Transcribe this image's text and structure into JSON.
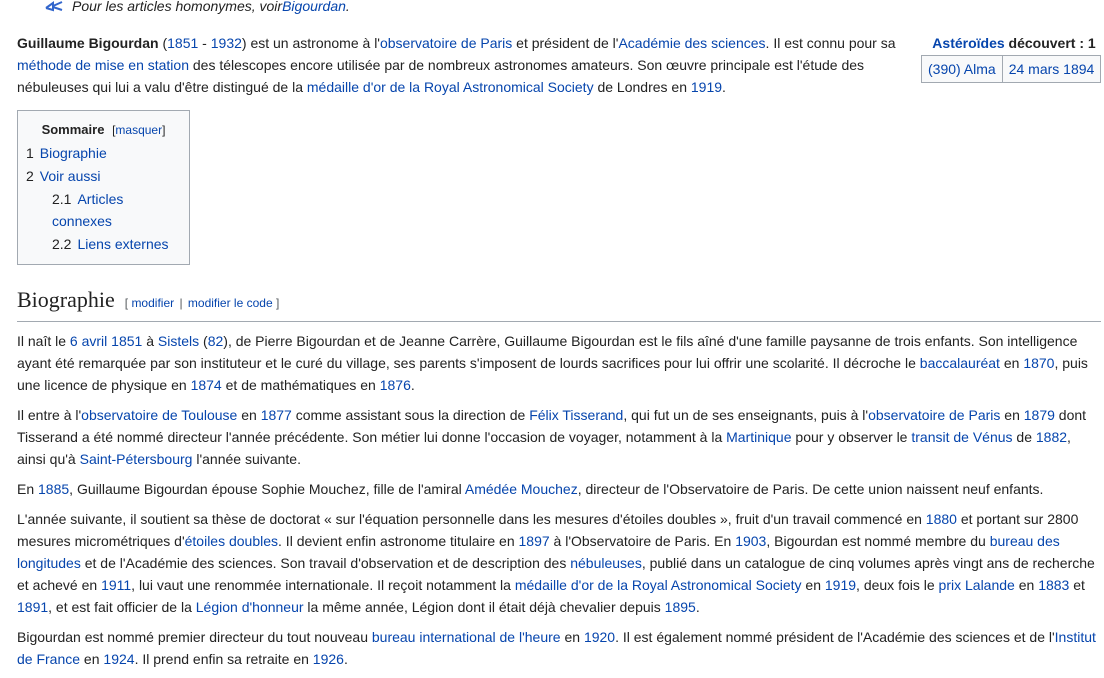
{
  "hatnote": {
    "text": "Pour les articles homonymes, voir ",
    "link": "Bigourdan",
    "end": "."
  },
  "infobox": {
    "title_link": "Astéroïdes",
    "title_rest": " découvert : 1",
    "rows": [
      {
        "name": "(390) Alma",
        "date": "24 mars 1894"
      }
    ]
  },
  "lead": [
    {
      "t": "Guillaume Bigourdan",
      "b": true
    },
    {
      "t": " ("
    },
    {
      "t": "1851",
      "l": true
    },
    {
      "t": " - "
    },
    {
      "t": "1932",
      "l": true
    },
    {
      "t": ") est un astronome à l'"
    },
    {
      "t": "observatoire de Paris",
      "l": true
    },
    {
      "t": " et président de l'"
    },
    {
      "t": "Académie des sciences",
      "l": true
    },
    {
      "t": ". Il est connu pour sa "
    },
    {
      "t": "méthode de mise en station",
      "l": true
    },
    {
      "t": " des télescopes encore utilisée par de nombreux astronomes amateurs. Son œuvre principale est l'étude des nébuleuses qui lui a valu d'être distingué de la "
    },
    {
      "t": "médaille d'or de la Royal Astronomical Society",
      "l": true
    },
    {
      "t": " de Londres en "
    },
    {
      "t": "1919",
      "l": true
    },
    {
      "t": "."
    }
  ],
  "toc": {
    "title": "Sommaire",
    "toggle_open": "[",
    "toggle": "masquer",
    "toggle_close": "]",
    "items": [
      {
        "num": "1",
        "label": "Biographie"
      },
      {
        "num": "2",
        "label": "Voir aussi"
      }
    ],
    "subitems": [
      {
        "num": "2.1",
        "label": "Articles connexes"
      },
      {
        "num": "2.2",
        "label": "Liens externes"
      }
    ]
  },
  "section": {
    "title": "Biographie",
    "edit_open": "[ ",
    "edit1": "modifier",
    "edit_sep": " | ",
    "edit2": "modifier le code",
    "edit_close": " ]"
  },
  "paragraphs": [
    [
      {
        "t": "Il naît le "
      },
      {
        "t": "6 avril",
        "l": true
      },
      {
        "t": " "
      },
      {
        "t": "1851",
        "l": true
      },
      {
        "t": " à "
      },
      {
        "t": "Sistels",
        "l": true
      },
      {
        "t": " ("
      },
      {
        "t": "82",
        "l": true
      },
      {
        "t": "), de Pierre Bigourdan et de Jeanne Carrère, Guillaume Bigourdan est le fils aîné d'une famille paysanne de trois enfants. Son intelligence ayant été remarquée par son instituteur et le curé du village, ses parents s'imposent de lourds sacrifices pour lui offrir une scolarité. Il décroche le "
      },
      {
        "t": "baccalauréat",
        "l": true
      },
      {
        "t": " en "
      },
      {
        "t": "1870",
        "l": true
      },
      {
        "t": ", puis une licence de physique en "
      },
      {
        "t": "1874",
        "l": true
      },
      {
        "t": " et de mathématiques en "
      },
      {
        "t": "1876",
        "l": true
      },
      {
        "t": "."
      }
    ],
    [
      {
        "t": "Il entre à l'"
      },
      {
        "t": "observatoire de Toulouse",
        "l": true
      },
      {
        "t": " en "
      },
      {
        "t": "1877",
        "l": true
      },
      {
        "t": " comme assistant sous la direction de "
      },
      {
        "t": "Félix Tisserand",
        "l": true
      },
      {
        "t": ", qui fut un de ses enseignants, puis à l'"
      },
      {
        "t": "observatoire de Paris",
        "l": true
      },
      {
        "t": " en "
      },
      {
        "t": "1879",
        "l": true
      },
      {
        "t": " dont Tisserand a été nommé directeur l'année précédente. Son métier lui donne l'occasion de voyager, notamment à la "
      },
      {
        "t": "Martinique",
        "l": true
      },
      {
        "t": " pour y observer le "
      },
      {
        "t": "transit de Vénus",
        "l": true
      },
      {
        "t": " de "
      },
      {
        "t": "1882",
        "l": true
      },
      {
        "t": ", ainsi qu'à "
      },
      {
        "t": "Saint-Pétersbourg",
        "l": true
      },
      {
        "t": " l'année suivante."
      }
    ],
    [
      {
        "t": "En "
      },
      {
        "t": "1885",
        "l": true
      },
      {
        "t": ", Guillaume Bigourdan épouse Sophie Mouchez, fille de l'amiral "
      },
      {
        "t": "Amédée Mouchez",
        "l": true
      },
      {
        "t": ", directeur de l'Observatoire de Paris. De cette union naissent neuf enfants."
      }
    ],
    [
      {
        "t": "L'année suivante, il soutient sa thèse de doctorat « sur l'équation personnelle dans les mesures d'étoiles doubles », fruit d'un travail commencé en "
      },
      {
        "t": "1880",
        "l": true
      },
      {
        "t": " et portant sur 2800 mesures micrométriques d'"
      },
      {
        "t": "étoiles doubles",
        "l": true
      },
      {
        "t": ". Il devient enfin astronome titulaire en "
      },
      {
        "t": "1897",
        "l": true
      },
      {
        "t": " à l'Observatoire de Paris. En "
      },
      {
        "t": "1903",
        "l": true
      },
      {
        "t": ", Bigourdan est nommé membre du "
      },
      {
        "t": "bureau des longitudes",
        "l": true
      },
      {
        "t": " et de l'Académie des sciences. Son travail d'observation et de description des "
      },
      {
        "t": "nébuleuses",
        "l": true
      },
      {
        "t": ", publié dans un catalogue de cinq volumes après vingt ans de recherche et achevé en "
      },
      {
        "t": "1911",
        "l": true
      },
      {
        "t": ", lui vaut une renommée internationale. Il reçoit notamment la "
      },
      {
        "t": "médaille d'or de la Royal Astronomical Society",
        "l": true
      },
      {
        "t": " en "
      },
      {
        "t": "1919",
        "l": true
      },
      {
        "t": ", deux fois le "
      },
      {
        "t": "prix Lalande",
        "l": true
      },
      {
        "t": " en "
      },
      {
        "t": "1883",
        "l": true
      },
      {
        "t": " et "
      },
      {
        "t": "1891",
        "l": true
      },
      {
        "t": ", et est fait officier de la "
      },
      {
        "t": "Légion d'honneur",
        "l": true
      },
      {
        "t": " la même année, Légion dont il était déjà chevalier depuis "
      },
      {
        "t": "1895",
        "l": true
      },
      {
        "t": "."
      }
    ],
    [
      {
        "t": "Bigourdan est nommé premier directeur du tout nouveau "
      },
      {
        "t": "bureau international de l'heure",
        "l": true
      },
      {
        "t": " en "
      },
      {
        "t": "1920",
        "l": true
      },
      {
        "t": ". Il est également nommé président de l'Académie des sciences et de l'"
      },
      {
        "t": "Institut de France",
        "l": true
      },
      {
        "t": " en "
      },
      {
        "t": "1924",
        "l": true
      },
      {
        "t": ". Il prend enfin sa retraite en "
      },
      {
        "t": "1926",
        "l": true
      },
      {
        "t": "."
      }
    ]
  ]
}
